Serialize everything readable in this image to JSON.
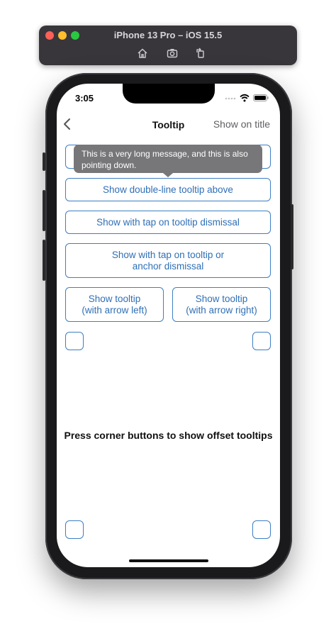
{
  "simulator": {
    "title": "iPhone 13 Pro – iOS 15.5",
    "tools": [
      "home-icon",
      "screenshot-icon",
      "rotate-icon"
    ]
  },
  "status_bar": {
    "time": "3:05"
  },
  "nav": {
    "title": "Tooltip",
    "right_item": "Show on title"
  },
  "tooltip": {
    "text": "This is a very long message, and this is also pointing down."
  },
  "buttons": {
    "double_line_above": "Show double-line tooltip above",
    "tap_tooltip_dismissal": "Show with tap on tooltip dismissal",
    "tap_tooltip_or_anchor_line1": "Show with tap on tooltip or",
    "tap_tooltip_or_anchor_line2": "anchor dismissal",
    "arrow_left_line1": "Show tooltip",
    "arrow_left_line2": "(with arrow left)",
    "arrow_right_line1": "Show tooltip",
    "arrow_right_line2": "(with arrow right)"
  },
  "center_label": "Press corner buttons to show offset tooltips",
  "colors": {
    "accent": "#2f6fb6",
    "tooltip_bg": "#777779"
  }
}
